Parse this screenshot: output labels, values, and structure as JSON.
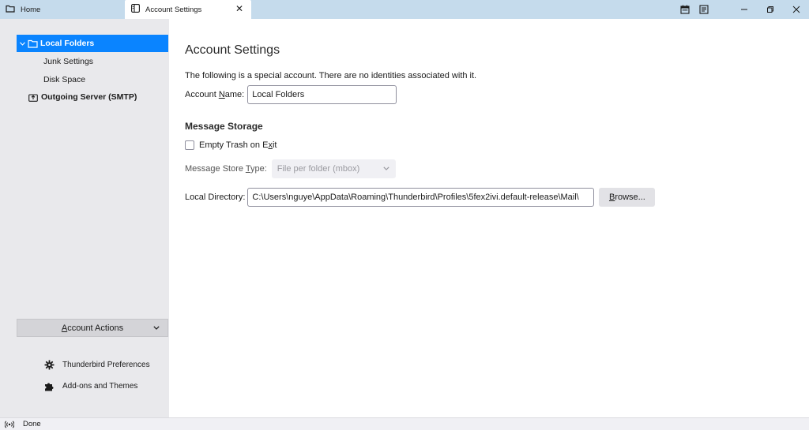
{
  "tabs": [
    {
      "label": "Home",
      "icon": "folder-icon"
    },
    {
      "label": "Account Settings",
      "icon": "settings-page-icon",
      "active": true
    }
  ],
  "window_controls": [
    "calendar-icon",
    "tasks-icon",
    "minimize-icon",
    "restore-icon",
    "close-icon"
  ],
  "sidebar": {
    "items": [
      {
        "label": "Local Folders",
        "selected": true,
        "icon": "folder-icon"
      },
      {
        "label": "Junk Settings"
      },
      {
        "label": "Disk Space"
      },
      {
        "label": "Outgoing Server (SMTP)",
        "icon": "outgoing-server-icon"
      }
    ],
    "account_actions": {
      "pre": "",
      "accel": "A",
      "post": "ccount Actions"
    },
    "links": [
      {
        "label": "Thunderbird Preferences",
        "icon": "gear-icon"
      },
      {
        "label": "Add-ons and Themes",
        "icon": "puzzle-icon"
      }
    ]
  },
  "main": {
    "title": "Account Settings",
    "description": "The following is a special account. There are no identities associated with it.",
    "account_name": {
      "pre": "Account ",
      "accel": "N",
      "post": "ame:",
      "value": "Local Folders"
    },
    "message_storage": {
      "heading": "Message Storage",
      "empty_trash": {
        "pre": "Empty Trash on E",
        "accel": "x",
        "post": "it",
        "checked": false
      },
      "store_type": {
        "pre": "Message Store ",
        "accel": "T",
        "post": "ype:",
        "value": "File per folder (mbox)"
      },
      "local_directory": {
        "label": "Local Directory:",
        "value": "C:\\Users\\nguye\\AppData\\Roaming\\Thunderbird\\Profiles\\5fex2ivi.default-release\\Mail\\"
      },
      "browse": {
        "pre": "",
        "accel": "B",
        "post": "rowse..."
      }
    }
  },
  "status": {
    "text": "Done"
  },
  "colors": {
    "accent": "#0a84ff",
    "tabbar": "#c5dbec",
    "sidebar": "#e9e9ec"
  }
}
